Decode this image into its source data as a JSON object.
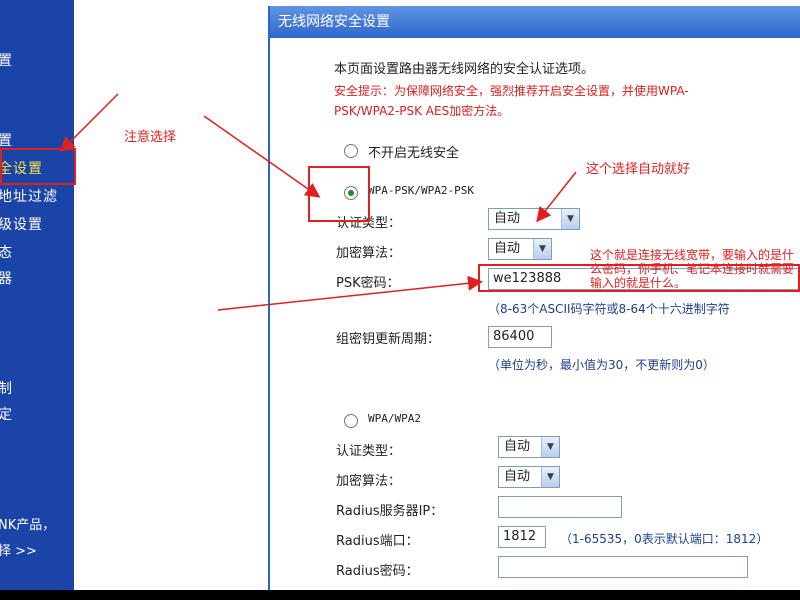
{
  "sidebar": {
    "items": [
      {
        "label": "置"
      },
      {
        "label": "置"
      },
      {
        "label": "全设置",
        "selected": true
      },
      {
        "label": "地址过滤"
      },
      {
        "label": "级设置"
      },
      {
        "label": "态"
      },
      {
        "label": "器"
      },
      {
        "label": "制"
      },
      {
        "label": "定"
      }
    ],
    "footer_line1": "NK产品，",
    "footer_line2": "择 >>"
  },
  "panel": {
    "title": "无线网络安全设置",
    "intro": "本页面设置路由器无线网络的安全认证选项。",
    "tip_line1": "安全提示：为保障网络安全，强烈推荐开启安全设置，并使用WPA-",
    "tip_line2": "PSK/WPA2-PSK AES加密方法。",
    "opt_disable": "不开启无线安全",
    "opt_wpapsk": "WPA-PSK/WPA2-PSK",
    "auth_label": "认证类型：",
    "auth_value": "自动",
    "enc_label": "加密算法：",
    "enc_value": "自动",
    "psk_label": "PSK密码：",
    "psk_value": "we123888",
    "psk_hint": "（8-63个ASCII码字符或8-64个十六进制字符",
    "gk_label": "组密钥更新周期：",
    "gk_value": "86400",
    "gk_hint": "（单位为秒，最小值为30，不更新则为0）",
    "opt_wpa": "WPA/WPA2",
    "auth2_label": "认证类型：",
    "auth2_value": "自动",
    "enc2_label": "加密算法：",
    "enc2_value": "自动",
    "radius_ip_label": "Radius服务器IP：",
    "radius_port_label": "Radius端口：",
    "radius_port_value": "1812",
    "radius_port_hint": "（1-65535，0表示默认端口：1812）",
    "radius_pwd_label": "Radius密码："
  },
  "annotations": {
    "select_note": "注意选择",
    "auto_note": "这个选择自动就好",
    "psk_note": "这个就是连接无线宽带，要输入的是什么密码，你手机、笔记本连接时就需要输入的就是什么。"
  },
  "icons": {
    "dropdown": "chevron-down-icon"
  },
  "colors": {
    "sidebar": "#1a44a8",
    "title_bar": "#2f66cc",
    "annotation": "#e02020"
  }
}
